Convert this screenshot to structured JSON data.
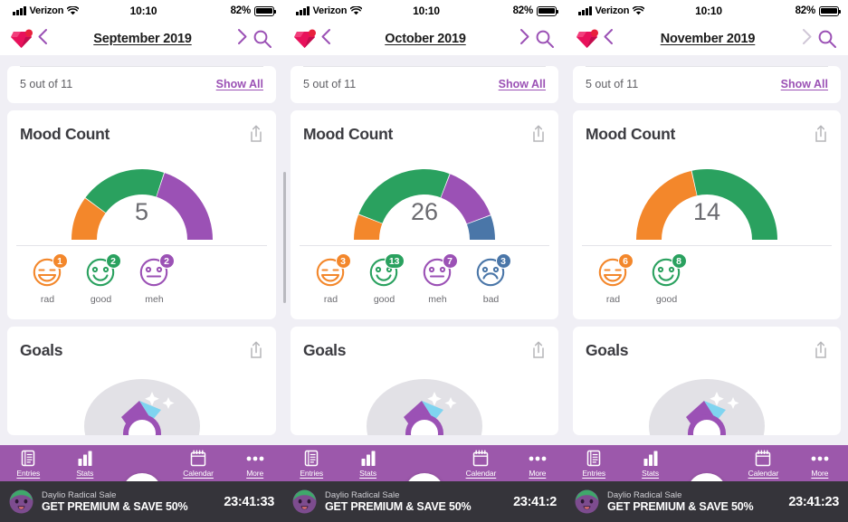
{
  "app": {
    "name": "Daylio",
    "logo_icon": "gem-icon",
    "notification_dot_color": "#e8213c"
  },
  "theme": {
    "accent": "#9b51b5",
    "tabbar": "#9c58ab",
    "background": "#f0eff5",
    "card": "#ffffff",
    "promo_bg": "#35343a",
    "mood_colors": {
      "rad": "#f3872b",
      "good": "#2aa15f",
      "meh": "#9b51b5",
      "bad": "#4a76a8"
    }
  },
  "status_bar": {
    "carrier": "Verizon",
    "time": "10:10",
    "battery": "82%",
    "signal_icon": "signal-bars-icon",
    "wifi_icon": "wifi-icon",
    "battery_icon": "battery-icon"
  },
  "panels": [
    {
      "nav": {
        "month": "September 2019",
        "prev_icon": "chevron-left-icon",
        "next_icon": "chevron-right-icon",
        "next_disabled": false,
        "search_icon": "search-icon",
        "search_visible": true
      },
      "summary": {
        "text": "5 out of 11",
        "link": "Show All"
      },
      "mood_count": {
        "title": "Mood Count",
        "share_icon": "share-icon",
        "total": "5",
        "moods": [
          {
            "label": "rad",
            "count": "1",
            "color": "#f3872b",
            "face": "rad-face-icon"
          },
          {
            "label": "good",
            "count": "2",
            "color": "#2aa15f",
            "face": "good-face-icon"
          },
          {
            "label": "meh",
            "count": "2",
            "color": "#9b51b5",
            "face": "meh-face-icon"
          }
        ]
      },
      "goals": {
        "title": "Goals",
        "share_icon": "share-icon"
      },
      "promo": {
        "small": "Daylio Radical Sale",
        "big": "GET PREMIUM & SAVE 50%",
        "timer": "23:41:33",
        "avatar_icon": "daylio-mascot-icon"
      }
    },
    {
      "nav": {
        "month": "October 2019",
        "prev_icon": "chevron-left-icon",
        "next_icon": "chevron-right-icon",
        "next_disabled": false,
        "search_icon": "search-icon",
        "search_visible": true
      },
      "summary": {
        "text": "5 out of 11",
        "link": "Show All"
      },
      "mood_count": {
        "title": "Mood Count",
        "share_icon": "share-icon",
        "total": "26",
        "moods": [
          {
            "label": "rad",
            "count": "3",
            "color": "#f3872b",
            "face": "rad-face-icon"
          },
          {
            "label": "good",
            "count": "13",
            "color": "#2aa15f",
            "face": "good-face-icon"
          },
          {
            "label": "meh",
            "count": "7",
            "color": "#9b51b5",
            "face": "meh-face-icon"
          },
          {
            "label": "bad",
            "count": "3",
            "color": "#4a76a8",
            "face": "bad-face-icon"
          }
        ]
      },
      "goals": {
        "title": "Goals",
        "share_icon": "share-icon"
      },
      "promo": {
        "small": "Daylio Radical Sale",
        "big": "GET PREMIUM & SAVE 50%",
        "timer": "23:41:2",
        "avatar_icon": "daylio-mascot-icon"
      }
    },
    {
      "nav": {
        "month": "November 2019",
        "prev_icon": "chevron-left-icon",
        "next_icon": "chevron-right-icon",
        "next_disabled": true,
        "search_icon": "search-icon",
        "search_visible": true
      },
      "summary": {
        "text": "5 out of 11",
        "link": "Show All"
      },
      "mood_count": {
        "title": "Mood Count",
        "share_icon": "share-icon",
        "total": "14",
        "moods": [
          {
            "label": "rad",
            "count": "6",
            "color": "#f3872b",
            "face": "rad-face-icon"
          },
          {
            "label": "good",
            "count": "8",
            "color": "#2aa15f",
            "face": "good-face-icon"
          }
        ]
      },
      "goals": {
        "title": "Goals",
        "share_icon": "share-icon"
      },
      "promo": {
        "small": "Daylio Radical Sale",
        "big": "GET PREMIUM & SAVE 50%",
        "timer": "23:41:23",
        "avatar_icon": "daylio-mascot-icon"
      }
    }
  ],
  "tabbar": {
    "items": [
      {
        "label": "Entries",
        "icon": "entries-icon",
        "active": false
      },
      {
        "label": "Stats",
        "icon": "stats-icon",
        "active": true
      },
      {
        "label": "Calendar",
        "icon": "calendar-icon",
        "active": false
      },
      {
        "label": "More",
        "icon": "more-dots-icon",
        "active": false
      }
    ],
    "add_button": {
      "icon": "plus-icon",
      "label": "+"
    }
  },
  "chart_data": [
    {
      "type": "pie",
      "title": "Mood Count",
      "subtitle": "September 2019",
      "shape": "half-donut-gauge",
      "total": 5,
      "labels": [
        "rad",
        "good",
        "meh"
      ],
      "values": [
        1,
        2,
        2
      ],
      "colors": [
        "#f3872b",
        "#2aa15f",
        "#9b51b5"
      ],
      "legend": "below-as-mood-faces-with-count-badges"
    },
    {
      "type": "pie",
      "title": "Mood Count",
      "subtitle": "October 2019",
      "shape": "half-donut-gauge",
      "total": 26,
      "labels": [
        "rad",
        "good",
        "meh",
        "bad"
      ],
      "values": [
        3,
        13,
        7,
        3
      ],
      "colors": [
        "#f3872b",
        "#2aa15f",
        "#9b51b5",
        "#4a76a8"
      ],
      "legend": "below-as-mood-faces-with-count-badges"
    },
    {
      "type": "pie",
      "title": "Mood Count",
      "subtitle": "November 2019",
      "shape": "half-donut-gauge",
      "total": 14,
      "labels": [
        "rad",
        "good"
      ],
      "values": [
        6,
        8
      ],
      "colors": [
        "#f3872b",
        "#2aa15f"
      ],
      "legend": "below-as-mood-faces-with-count-badges"
    }
  ]
}
